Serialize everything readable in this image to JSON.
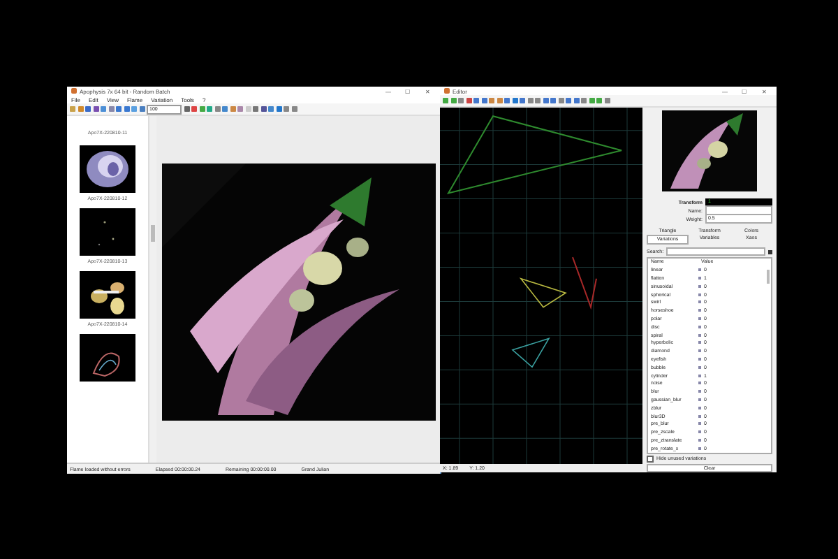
{
  "main_window": {
    "title": "Apophysis 7x 64 bit - Random Batch",
    "controls": [
      "—",
      "☐",
      "✕"
    ],
    "menu": [
      "File",
      "Edit",
      "View",
      "Flame",
      "Variation",
      "Tools",
      "?"
    ],
    "zoom_combo": "100",
    "thumbnails": [
      {
        "label": "Apo7X-220810-11",
        "kind": "blank"
      },
      {
        "label": "Apo7X-220810-12",
        "kind": "picture"
      },
      {
        "label": "Apo7X-220810-13",
        "kind": "picture"
      },
      {
        "label": "Apo7X-220810-14",
        "kind": "picture"
      },
      {
        "kind": "picture"
      }
    ],
    "status_bar": [
      "Flame loaded without errors",
      "Elapsed 00:00:00.24",
      "Remaining 00:00:00.00",
      "Grand Julian"
    ]
  },
  "editor": {
    "title": "Editor",
    "controls": [
      "—",
      "☐",
      "✕"
    ],
    "coords": [
      "X: 1.89",
      "Y: 1.20"
    ],
    "transform": {
      "label": "Transform",
      "value": "1"
    },
    "name_label": "Name:",
    "weight_label": "Weight:",
    "weight": "0.5",
    "tabs": [
      {
        "label": "Triangle",
        "selected": false
      },
      {
        "label": "Transform",
        "selected": false
      },
      {
        "label": "Colors",
        "selected": false
      },
      {
        "label": "Variations",
        "selected": true
      },
      {
        "label": "Variables",
        "selected": false
      },
      {
        "label": "Xaos",
        "selected": false
      }
    ],
    "search_label": "Search:",
    "columns": [
      "Name",
      "Value"
    ],
    "variations": [
      {
        "name": "linear",
        "value": "0"
      },
      {
        "name": "flatten",
        "value": "1"
      },
      {
        "name": "sinusoidal",
        "value": "0"
      },
      {
        "name": "spherical",
        "value": "0"
      },
      {
        "name": "swirl",
        "value": "0"
      },
      {
        "name": "horseshoe",
        "value": "0"
      },
      {
        "name": "polar",
        "value": "0"
      },
      {
        "name": "disc",
        "value": "0"
      },
      {
        "name": "spiral",
        "value": "0"
      },
      {
        "name": "hyperbolic",
        "value": "0"
      },
      {
        "name": "diamond",
        "value": "0"
      },
      {
        "name": "eyefish",
        "value": "0"
      },
      {
        "name": "bubble",
        "value": "0"
      },
      {
        "name": "cylinder",
        "value": "1"
      },
      {
        "name": "noise",
        "value": "0"
      },
      {
        "name": "blur",
        "value": "0"
      },
      {
        "name": "gaussian_blur",
        "value": "0"
      },
      {
        "name": "zblur",
        "value": "0"
      },
      {
        "name": "blur3D",
        "value": "0"
      },
      {
        "name": "pre_blur",
        "value": "0"
      },
      {
        "name": "pre_zscale",
        "value": "0"
      },
      {
        "name": "pre_ztranslate",
        "value": "0"
      },
      {
        "name": "pre_rotate_x",
        "value": "0"
      }
    ],
    "hide_unused": {
      "label": "Hide unused variations",
      "checked": false
    },
    "clear_button": "Clear"
  }
}
